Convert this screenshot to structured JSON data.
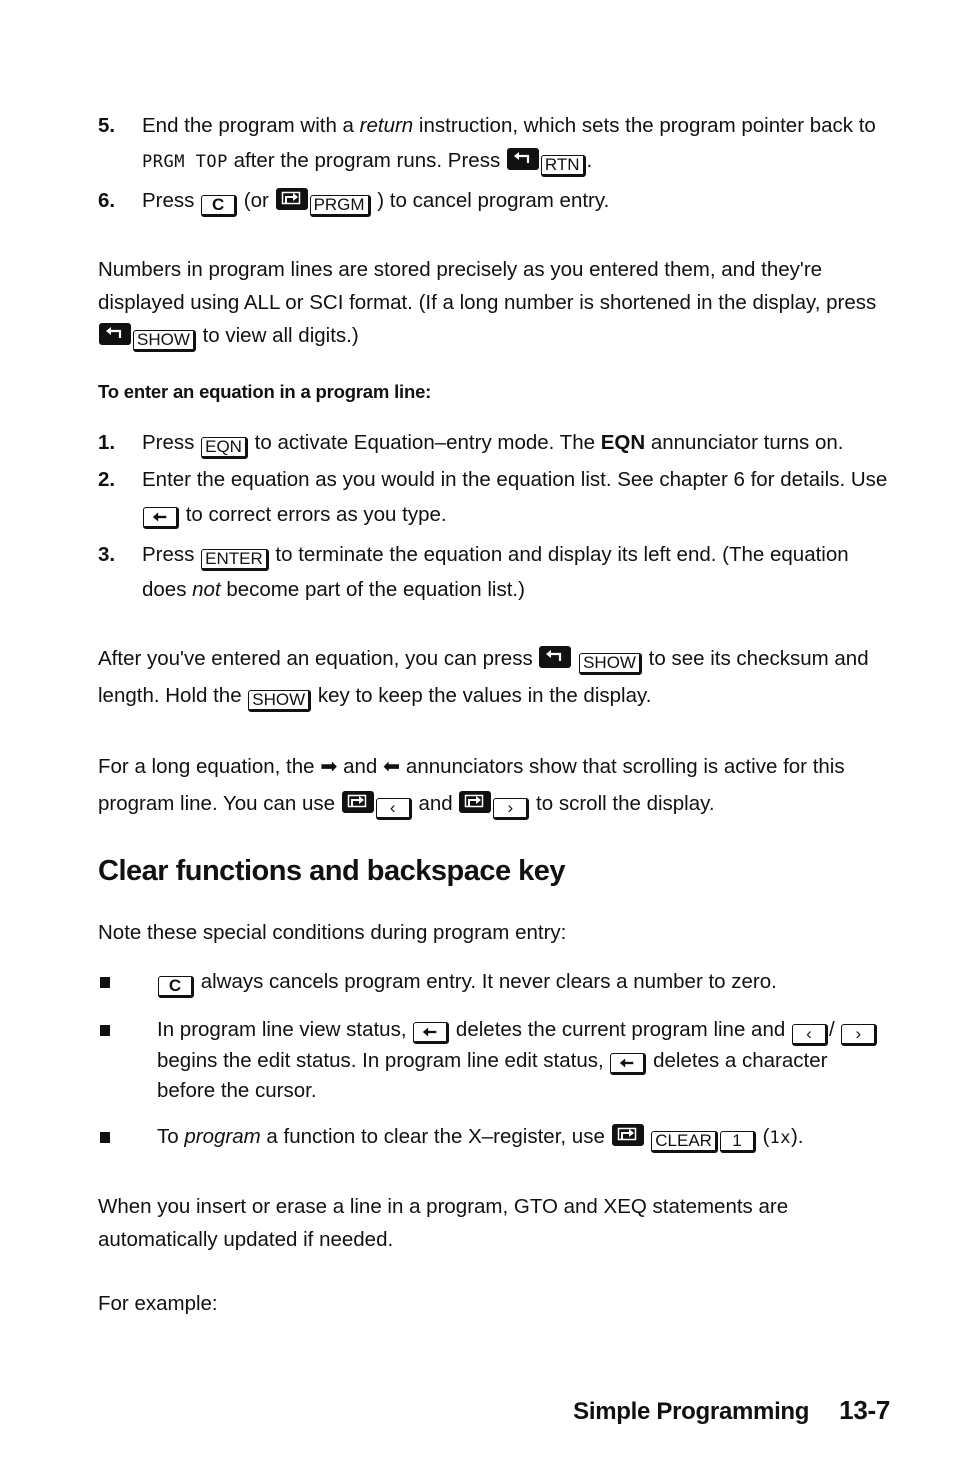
{
  "steps_a": [
    {
      "num": "5.",
      "t1": "End the program with a ",
      "t1_italic": "return",
      "t2": " instruction, which sets the program pointer back to ",
      "lcd": "PRGM TOP",
      "t3": " after the program runs. Press ",
      "key": "RTN",
      "t4": "."
    },
    {
      "num": "6.",
      "t1": "Press ",
      "key_c": "C",
      "t2": " (or ",
      "key": "PRGM",
      "t3": " ) to cancel program entry."
    }
  ],
  "para_numbers": {
    "t1": "Numbers in program lines are stored precisely as you entered them, and they're displayed using ALL or SCI format. (If a long number is shortened in the display, press ",
    "key": "SHOW",
    "t2": " to view all digits.)"
  },
  "subhead": "To enter an equation in a program line:",
  "steps_b": [
    {
      "num": "1.",
      "t1": "Press ",
      "key": "EQN",
      "t2": " to activate Equation–entry mode. The ",
      "bold": "EQN",
      "t3": " annunciator turns on."
    },
    {
      "num": "2.",
      "t1": "Enter the equation as you would in the equation list. See chapter 6 for details. Use ",
      "t2": " to correct errors as you type."
    },
    {
      "num": "3.",
      "t1": "Press ",
      "key": "ENTER",
      "t2": " to terminate the equation and display its left end. (The equation does ",
      "t2_italic": "not",
      "t3": " become part of the equation list.)"
    }
  ],
  "para_checksum": {
    "t1": "After you've entered an equation, you can press ",
    "key": "SHOW",
    "t2": " to see its checksum and length. Hold the ",
    "t3": " key to keep the values in the display."
  },
  "para_scroll": {
    "t1": "For a long equation, the ",
    "t2": " and ",
    "t3": " annunciators show that scrolling is active for this program line. You can use ",
    "t4": " and ",
    "t5": " to scroll the display."
  },
  "heading": "Clear functions and backspace key",
  "intro": "Note these special conditions during program entry:",
  "bullets": [
    {
      "key": "C",
      "t1": " always cancels program entry. It never clears a number to zero."
    },
    {
      "t1": "In program line view status, ",
      "t2": " deletes the current program line and ",
      "t3": "/ ",
      "t4": " begins the edit status. In program line edit status, ",
      "t5": " deletes a character before the cursor."
    },
    {
      "t1": "To ",
      "t1_italic": "program",
      "t2": " a function to clear the X–register, use ",
      "key": "CLEAR",
      "key2": "1",
      "t3": " (",
      "lcd": "1x",
      "t4": ")."
    }
  ],
  "para_update": "When you insert or erase a line in a program, GTO and XEQ statements are automatically updated if needed.",
  "para_example": "For example:",
  "footer": {
    "title": "Simple Programming",
    "page": "13-7"
  }
}
